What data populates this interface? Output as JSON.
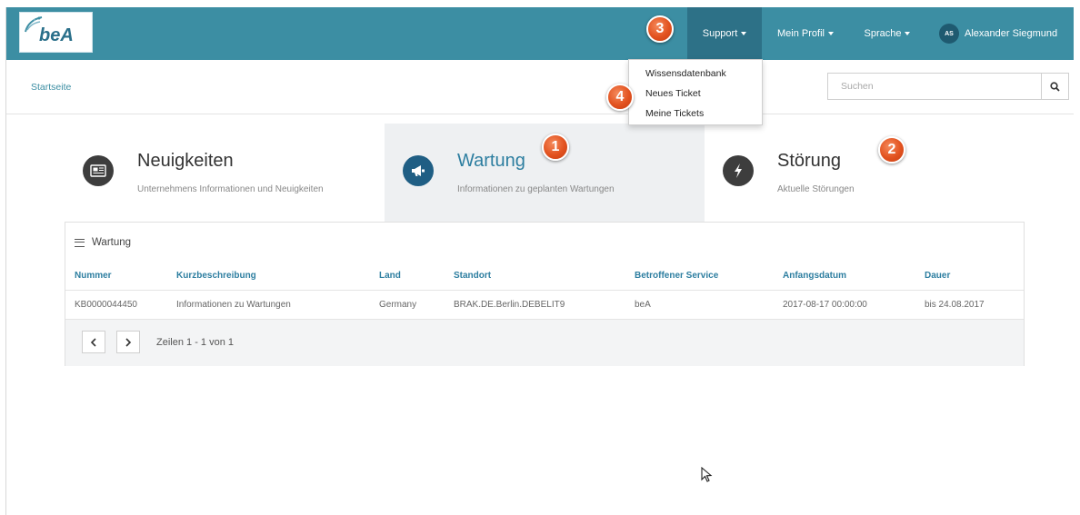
{
  "app": {
    "logo_text": "beA"
  },
  "header": {
    "nav": {
      "support": "Support",
      "profil": "Mein Profil",
      "sprache": "Sprache",
      "user_initials": "AS",
      "user_name": "Alexander Siegmund"
    },
    "support_menu": [
      "Wissensdatenbank",
      "Neues Ticket",
      "Meine Tickets"
    ]
  },
  "breadcrumb": "Startseite",
  "search": {
    "placeholder": "Suchen"
  },
  "cards": [
    {
      "title": "Neuigkeiten",
      "desc": "Unternehmens Informationen und Neuigkeiten",
      "icon": "newspaper-icon"
    },
    {
      "title": "Wartung",
      "desc": "Informationen zu geplanten Wartungen",
      "icon": "megaphone-icon"
    },
    {
      "title": "Störung",
      "desc": "Aktuelle Störungen",
      "icon": "lightning-icon"
    }
  ],
  "panel": {
    "title": "Wartung",
    "columns": [
      "Nummer",
      "Kurzbeschreibung",
      "Land",
      "Standort",
      "Betroffener Service",
      "Anfangsdatum",
      "Dauer"
    ],
    "rows": [
      [
        "KB0000044450",
        "Informationen zu Wartungen",
        "Germany",
        "BRAK.DE.Berlin.DEBELIT9",
        "beA",
        "2017-08-17 00:00:00",
        "bis 24.08.2017"
      ]
    ],
    "pager_info": "Zeilen 1 - 1 von 1"
  },
  "annotations": [
    "1",
    "2",
    "3",
    "4"
  ],
  "colors": {
    "header_bg": "#3c8ea3",
    "accent": "#2d7ea0",
    "badge": "#e2521f"
  }
}
